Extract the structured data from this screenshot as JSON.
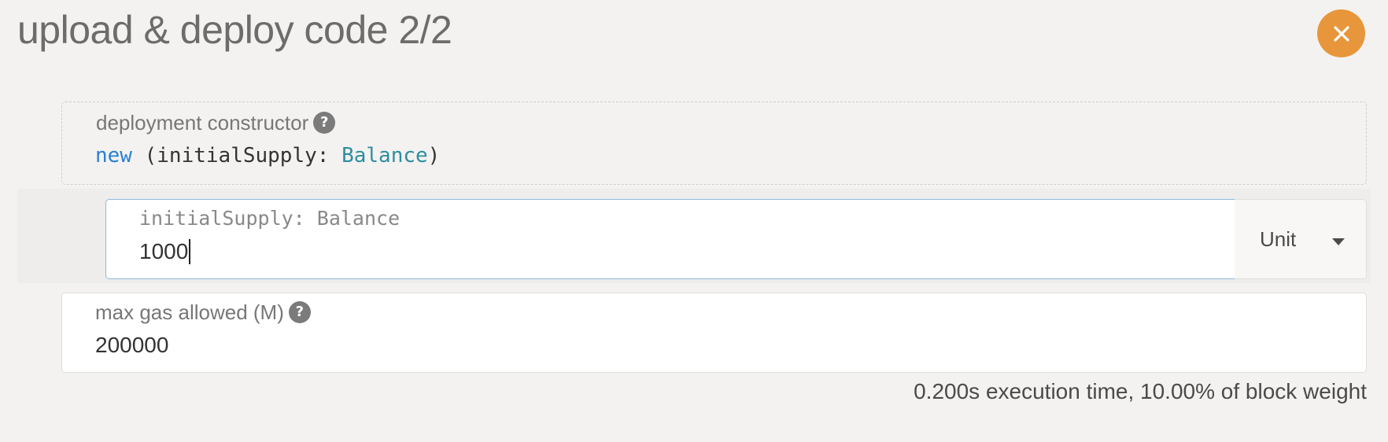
{
  "modal": {
    "title": "upload & deploy code 2/2",
    "close_icon": "close-icon"
  },
  "constructor": {
    "label": "deployment constructor",
    "help_icon": "?",
    "signature": {
      "keyword": "new",
      "open": " (initialSupply: ",
      "type": "Balance",
      "close": ")"
    }
  },
  "param": {
    "label": "initialSupply: Balance",
    "value": "1000",
    "unit": "Unit",
    "unit_icon": "chevron-down-icon"
  },
  "gas": {
    "label": "max gas allowed (M)",
    "help_icon": "?",
    "value": "200000"
  },
  "execution_info": "0.200s execution time, 10.00% of block weight",
  "colors": {
    "background": "#f3f2f0",
    "accent": "#e8963b",
    "keyword": "#2a7fd4",
    "type": "#2c8ea0",
    "input_focus_border": "#8fb7d9"
  }
}
